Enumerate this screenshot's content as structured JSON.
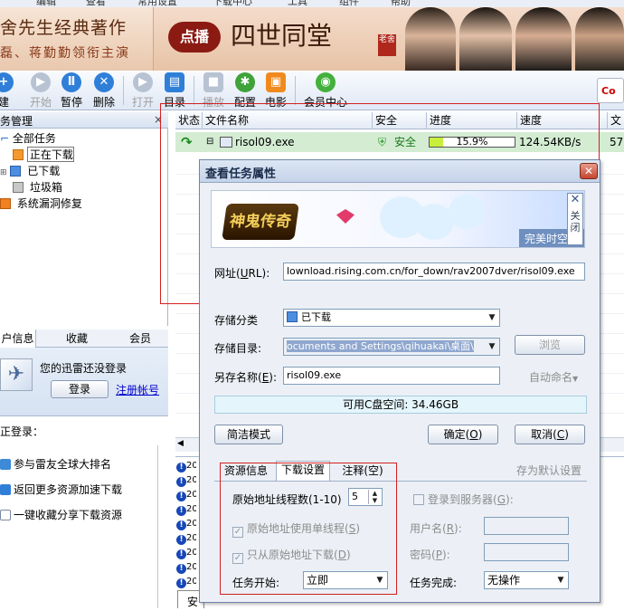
{
  "menu": [
    "编辑",
    "查看",
    "常用设置",
    "下载中心",
    "工具",
    "组件",
    "帮助"
  ],
  "banner": {
    "left_line1": "舍先生经典著作",
    "left_line2": "磊、蒋勤勤领衔主演",
    "play": "点播",
    "title": "四世同堂",
    "seal": "老舍"
  },
  "toolbar": {
    "items": [
      {
        "label": "建",
        "icon": "new-icon"
      },
      {
        "label": "开始",
        "icon": "start-icon"
      },
      {
        "label": "暂停",
        "icon": "pause-icon"
      },
      {
        "label": "删除",
        "icon": "delete-icon"
      },
      {
        "label": "打开",
        "icon": "open-icon"
      },
      {
        "label": "目录",
        "icon": "folder-icon"
      },
      {
        "label": "播放",
        "icon": "play-icon"
      },
      {
        "label": "配置",
        "icon": "config-icon"
      },
      {
        "label": "电影",
        "icon": "movie-icon"
      },
      {
        "label": "会员中心",
        "icon": "member-icon"
      }
    ]
  },
  "left_panel": {
    "title": "务管理",
    "close": "×",
    "tree": [
      "全部任务",
      "正在下载",
      "已下载",
      "垃圾箱",
      "系统漏洞修复"
    ],
    "info_tabs": [
      "户信息",
      "收藏",
      "会员"
    ],
    "login_msg": "您的迅雷还没登录",
    "login_btn": "登录",
    "register": "注册帐号",
    "quick_title": "正登录：",
    "quick_items": [
      "参与雷友全球大排名",
      "返回更多资源加速下载",
      "一键收藏分享下载资源"
    ]
  },
  "task_list": {
    "columns": [
      "状态",
      "文件名称",
      "安全",
      "进度",
      "速度",
      "文"
    ],
    "row": {
      "name": "risol09.exe",
      "safety": "安全",
      "progress_text": "15.9%",
      "progress": 0.159,
      "speed": "124.54KB/s",
      "extra": "57."
    },
    "log_prefix": "20",
    "bottom_tab": "安"
  },
  "dialog": {
    "title": "查看任务属性",
    "close": "✕",
    "ad": {
      "game": "神鬼传奇",
      "strip": "完美时空",
      "close_label": "关闭"
    },
    "url_label": "网址",
    "url_key": "U",
    "url_value": "lownload.rising.com.cn/for_down/rav2007dver/risol09.exe",
    "category_label": "存储分类",
    "category_value": "已下载",
    "dir_label": "存储目录:",
    "dir_value": "ocuments and Settings\\qihuakai\\桌面\\",
    "browse": "浏览",
    "saveas_label": "另存名称",
    "saveas_key": "E",
    "saveas_value": "risol09.exe",
    "auto_name": "自动命名",
    "space": "可用C盘空间: 34.46GB",
    "simple_mode": "简洁模式",
    "ok": "确定",
    "ok_key": "O",
    "cancel": "取消",
    "cancel_key": "C",
    "tabs": [
      "资源信息",
      "下载设置",
      "注释(空)"
    ],
    "save_default": "存为默认设置",
    "threads_label": "原始地址线程数(1-10)",
    "threads_value": "5",
    "single_thread": "原始地址使用单线程",
    "single_key": "S",
    "only_origin": "只从原始地址下载",
    "only_key": "D",
    "login_server": "登录到服务器",
    "login_key": "G",
    "username": "用户名",
    "username_key": "R",
    "password": "密码",
    "password_key": "P",
    "start_label": "任务开始:",
    "start_value": "立即",
    "finish_label": "任务完成:",
    "finish_value": "无操作"
  }
}
